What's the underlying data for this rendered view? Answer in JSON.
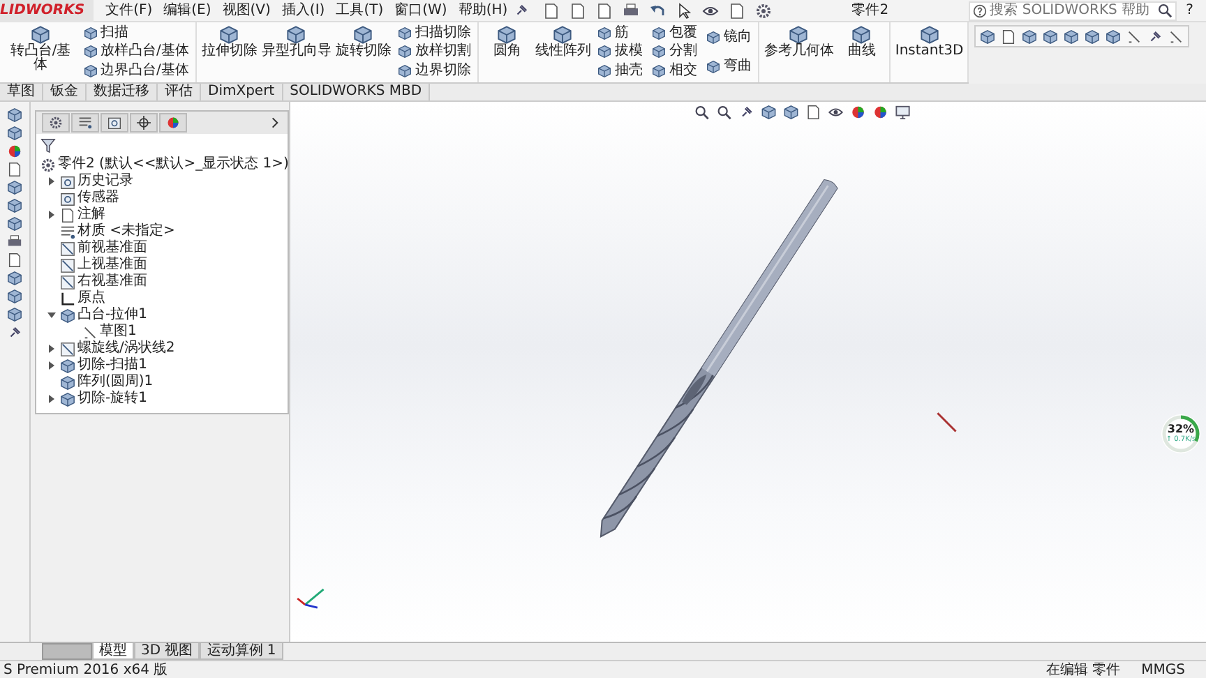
{
  "app_logo": "LIDWORKS",
  "menu": [
    "文件(F)",
    "编辑(E)",
    "视图(V)",
    "插入(I)",
    "工具(T)",
    "窗口(W)",
    "帮助(H)"
  ],
  "document_title": "零件2",
  "search": {
    "placeholder": "搜索 SOLIDWORKS 帮助"
  },
  "help_button": "?",
  "ribbon": [
    {
      "large": [
        "转凸台/基体"
      ],
      "small": [
        [
          "扫描",
          "放样凸台/基体",
          "边界凸台/基体"
        ]
      ]
    },
    {
      "large": [
        "拉伸切除",
        "异型孔向导",
        "旋转切除"
      ],
      "small": [
        [
          "扫描切除",
          "放样切割",
          "边界切除"
        ]
      ]
    },
    {
      "large": [
        "圆角",
        "线性阵列"
      ],
      "small": [
        [
          "筋",
          "拔模",
          "抽壳"
        ],
        [
          "包覆",
          "分割",
          "相交"
        ],
        [
          "镜向",
          "弯曲"
        ]
      ]
    },
    {
      "large": [
        "参考几何体",
        "曲线"
      ]
    },
    {
      "large": [
        "Instant3D"
      ]
    }
  ],
  "command_tabs": [
    "草图",
    "钣金",
    "数据迁移",
    "评估",
    "DimXpert",
    "SOLIDWORKS MBD"
  ],
  "feature_tree": {
    "root": "零件2 (默认<<默认>_显示状态 1>)",
    "items": [
      {
        "label": "历史记录",
        "expanded": false
      },
      {
        "label": "传感器"
      },
      {
        "label": "注解",
        "expanded": false
      },
      {
        "label": "材质 <未指定>"
      },
      {
        "label": "前视基准面"
      },
      {
        "label": "上视基准面"
      },
      {
        "label": "右视基准面"
      },
      {
        "label": "原点"
      },
      {
        "label": "凸台-拉伸1",
        "expanded": true,
        "children": [
          {
            "label": "草图1"
          }
        ]
      },
      {
        "label": "螺旋线/涡状线2",
        "expanded": false
      },
      {
        "label": "切除-扫描1",
        "expanded": false
      },
      {
        "label": "阵列(圆周)1"
      },
      {
        "label": "切除-旋转1",
        "expanded": false
      }
    ]
  },
  "progress": {
    "percent": "32%",
    "speed": "↑ 0.7K/s",
    "level": 0.32
  },
  "view_tabs": [
    {
      "label": "模型",
      "selected": true
    },
    {
      "label": "3D 视图",
      "selected": false
    },
    {
      "label": "运动算例 1",
      "selected": false
    }
  ],
  "status_bar": {
    "left": "S Premium 2016 x64 版",
    "right": [
      "在编辑 零件",
      "MMGS"
    ]
  }
}
